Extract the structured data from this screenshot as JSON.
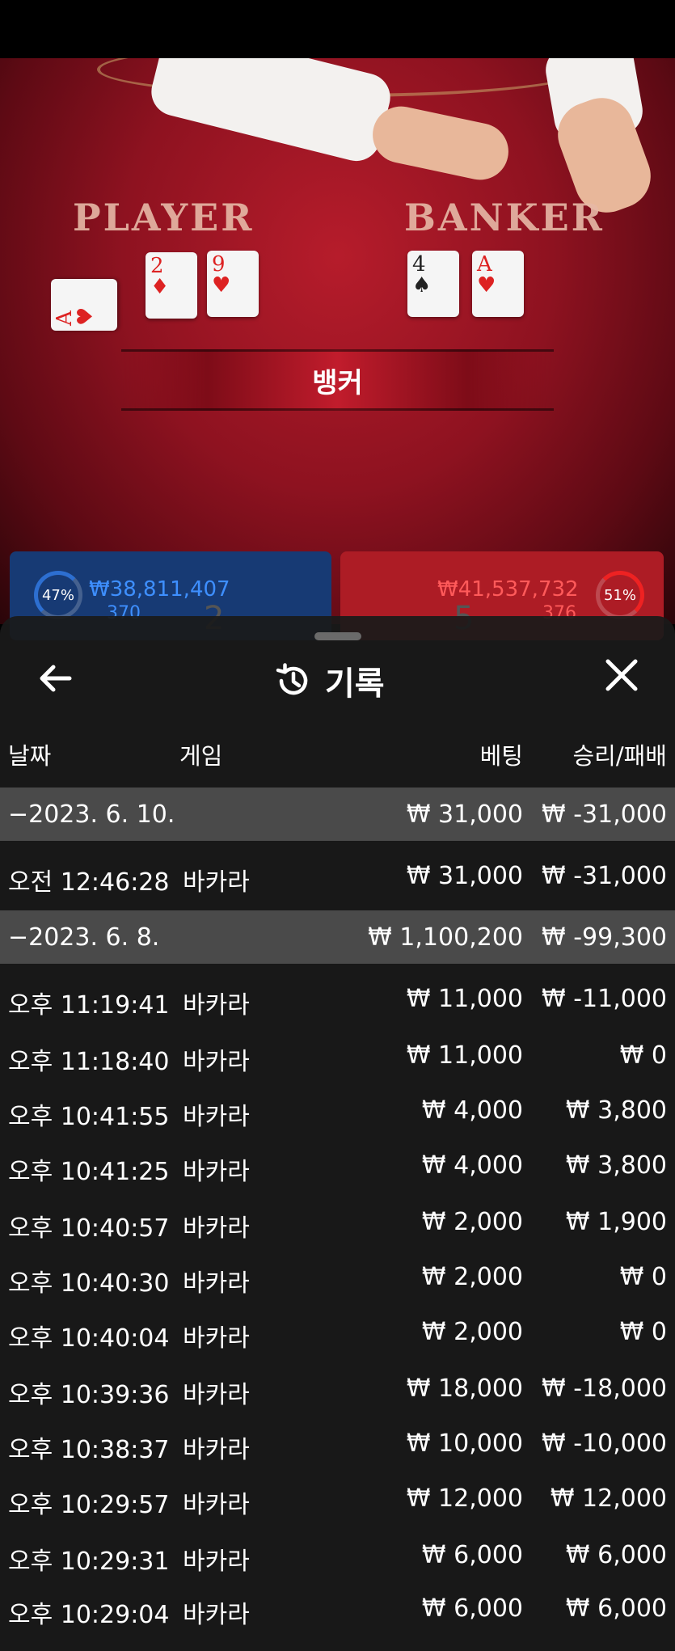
{
  "video": {
    "player_label": "PLAYER",
    "banker_label": "BANKER",
    "player_cards": [
      {
        "rank": "A",
        "suit": "♥",
        "color": "red"
      },
      {
        "rank": "2",
        "suit": "♦",
        "color": "red"
      },
      {
        "rank": "9",
        "suit": "♥",
        "color": "red"
      }
    ],
    "banker_cards": [
      {
        "rank": "4",
        "suit": "♠",
        "color": "black"
      },
      {
        "rank": "A",
        "suit": "♥",
        "color": "red"
      }
    ],
    "result": "뱅커"
  },
  "bet_panels": {
    "player": {
      "percent": "47%",
      "amount": "₩38,811,407",
      "players": "370",
      "score": "2"
    },
    "banker": {
      "percent": "51%",
      "amount": "₩41,537,732",
      "players": "376",
      "score": "5"
    }
  },
  "sheet": {
    "title": "기록",
    "columns": {
      "date": "날짜",
      "game": "게임",
      "bet": "베팅",
      "winloss": "승리/패배"
    },
    "rows": [
      {
        "type": "date",
        "time": "−2023. 6. 10.",
        "game": "",
        "bet": "₩ 31,000",
        "win": "₩ -31,000"
      },
      {
        "type": "entry",
        "time": "오전 12:46:28",
        "game": "바카라",
        "bet": "₩ 31,000",
        "win": "₩ -31,000"
      },
      {
        "type": "date",
        "time": "−2023. 6. 8.",
        "game": "",
        "bet": "₩ 1,100,200",
        "win": "₩ -99,300"
      },
      {
        "type": "entry",
        "time": "오후 11:19:41",
        "game": "바카라",
        "bet": "₩ 11,000",
        "win": "₩ -11,000"
      },
      {
        "type": "entry",
        "time": "오후 11:18:40",
        "game": "바카라",
        "bet": "₩ 11,000",
        "win": "₩ 0"
      },
      {
        "type": "entry",
        "time": "오후 10:41:55",
        "game": "바카라",
        "bet": "₩ 4,000",
        "win": "₩ 3,800"
      },
      {
        "type": "entry",
        "time": "오후 10:41:25",
        "game": "바카라",
        "bet": "₩ 4,000",
        "win": "₩ 3,800"
      },
      {
        "type": "entry",
        "time": "오후 10:40:57",
        "game": "바카라",
        "bet": "₩ 2,000",
        "win": "₩ 1,900"
      },
      {
        "type": "entry",
        "time": "오후 10:40:30",
        "game": "바카라",
        "bet": "₩ 2,000",
        "win": "₩ 0"
      },
      {
        "type": "entry",
        "time": "오후 10:40:04",
        "game": "바카라",
        "bet": "₩ 2,000",
        "win": "₩ 0"
      },
      {
        "type": "entry",
        "time": "오후 10:39:36",
        "game": "바카라",
        "bet": "₩ 18,000",
        "win": "₩ -18,000"
      },
      {
        "type": "entry",
        "time": "오후 10:38:37",
        "game": "바카라",
        "bet": "₩ 10,000",
        "win": "₩ -10,000"
      },
      {
        "type": "entry",
        "time": "오후 10:29:57",
        "game": "바카라",
        "bet": "₩ 12,000",
        "win": "₩ 12,000"
      },
      {
        "type": "entry",
        "time": "오후 10:29:31",
        "game": "바카라",
        "bet": "₩ 6,000",
        "win": "₩ 6,000"
      },
      {
        "type": "entry",
        "time": "오후 10:29:04",
        "game": "바카라",
        "bet": "₩ 6,000",
        "win": "₩ 6,000"
      }
    ]
  },
  "icons": {
    "back": "arrow-left-icon",
    "history": "history-icon",
    "close": "close-icon"
  },
  "colors": {
    "player_blue": "#173a74",
    "banker_red": "#ad1c25",
    "table_red": "#8e1220",
    "sheet_bg": "#1a1a1a",
    "date_row_bg": "#4a4a4a"
  }
}
